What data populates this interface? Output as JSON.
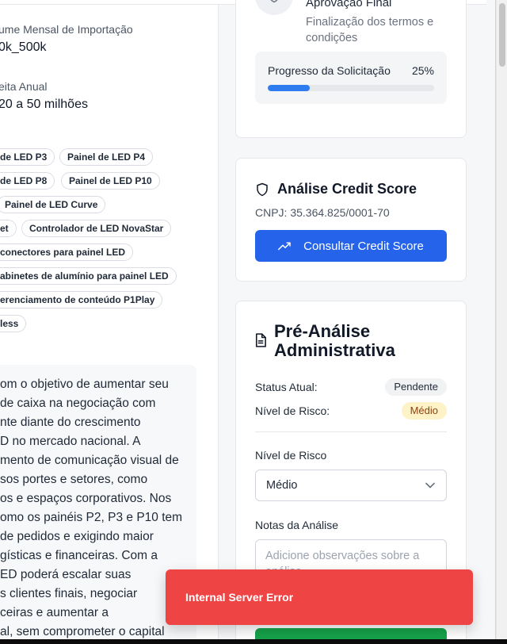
{
  "left": {
    "volume_label": "ume Mensal de Importação",
    "volume_value": "0k_500k",
    "revenue_label": "eita Anual",
    "revenue_value": "20 a 50 milhões",
    "tags": [
      "de LED P3",
      "Painel de LED P4",
      "de LED P8",
      "Painel de LED P10",
      "Painel de LED Curve",
      "et",
      "Controlador de LED NovaStar",
      "conectores para painel LED",
      "abinetes de alumínio para painel LED",
      "erenciamento de conteúdo P1Play",
      "less"
    ],
    "description_lines": [
      "om o objetivo de aumentar seu",
      " de caixa na negociação com",
      "nte diante do crescimento",
      "D no mercado nacional. A",
      "mento de comunicação visual de",
      "sos portes e setores, como",
      "os e espaços corporativos. Nos",
      "omo os painéis P2, P3 e P10 tem",
      " de pedidos e exigindo maior",
      "gísticas e financeiras. Com a",
      "ED poderá escalar suas",
      "s clientes finais, negociar",
      "ceiras e aumentar a",
      "al, sem comprometer o capital"
    ]
  },
  "approval": {
    "step_title": "Aprovação Final",
    "step_desc_1": "Finalização dos termos e",
    "step_desc_2": "condições",
    "progress_label": "Progresso da Solicitação",
    "progress_value": "25%",
    "progress_fraction": 0.25
  },
  "credit": {
    "title": "Análise Credit Score",
    "cnpj": "CNPJ: 35.364.825/0001-70",
    "button_label": "Consultar Credit Score"
  },
  "pre_analysis": {
    "title_line1": "Pré-Análise",
    "title_line2": "Administrativa",
    "status_label": "Status Atual:",
    "status_value": "Pendente",
    "risk_label": "Nível de Risco:",
    "risk_value": "Médio",
    "risk_select_label": "Nível de Risco",
    "risk_select_value": "Médio",
    "notes_label": "Notas da Análise",
    "notes_placeholder": "Adicione observações sobre a análise..."
  },
  "toast": {
    "message": "Internal Server Error",
    "color": "#ef4444"
  },
  "colors": {
    "primary": "#2563eb",
    "progress": "#2f7bf0",
    "risk_badge_bg": "#fef3c7",
    "success": "#16a34a"
  }
}
